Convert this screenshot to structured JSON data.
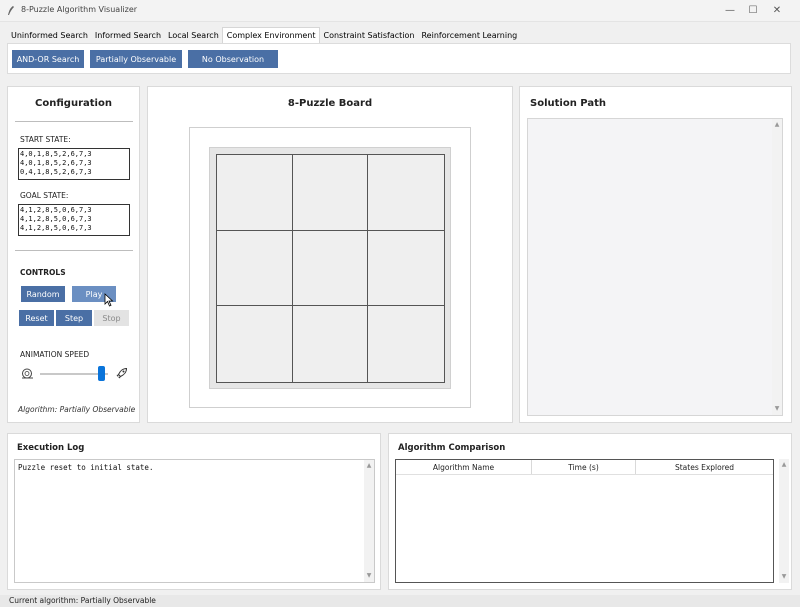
{
  "window": {
    "title": "8-Puzzle Algorithm Visualizer",
    "minimize_glyph": "—",
    "maximize_glyph": "☐",
    "close_glyph": "✕"
  },
  "tabs": [
    {
      "label": "Uninformed Search",
      "active": false
    },
    {
      "label": "Informed Search",
      "active": false
    },
    {
      "label": "Local Search",
      "active": false
    },
    {
      "label": "Complex Environment",
      "active": true
    },
    {
      "label": "Constraint Satisfaction",
      "active": false
    },
    {
      "label": "Reinforcement Learning",
      "active": false
    }
  ],
  "subtabs": {
    "and_or": "AND-OR Search",
    "partially_observable": "Partially Observable",
    "no_observation": "No Observation"
  },
  "config": {
    "title": "Configuration",
    "start_label": "START STATE:",
    "start_lines": [
      "4,0,1,8,5,2,6,7,3",
      "4,0,1,8,5,2,6,7,3",
      "0,4,1,8,5,2,6,7,3"
    ],
    "goal_label": "GOAL STATE:",
    "goal_lines": [
      "4,1,2,8,5,0,6,7,3",
      "4,1,2,8,5,0,6,7,3",
      "4,1,2,8,5,0,6,7,3"
    ],
    "controls_label": "CONTROLS",
    "random_label": "Random",
    "play_label": "Play",
    "reset_label": "Reset",
    "step_label": "Step",
    "stop_label": "Stop",
    "speed_label": "ANIMATION SPEED",
    "speed_value": 0.9,
    "algorithm_label": "Algorithm: Partially Observable"
  },
  "board": {
    "title": "8-Puzzle Board",
    "tiles": [
      "",
      "",
      "",
      "",
      "",
      "",
      "",
      "",
      ""
    ]
  },
  "solution": {
    "title": "Solution Path"
  },
  "log": {
    "title": "Execution Log",
    "text": "Puzzle reset to initial state."
  },
  "comparison": {
    "title": "Algorithm Comparison",
    "columns": [
      "Algorithm Name",
      "Time (s)",
      "States Explored"
    ]
  },
  "status": {
    "text": "Current algorithm: Partially Observable"
  },
  "colors": {
    "button": "#4a6fa5",
    "button_hover": "#6b8fc2",
    "slider_thumb": "#0a74da"
  }
}
